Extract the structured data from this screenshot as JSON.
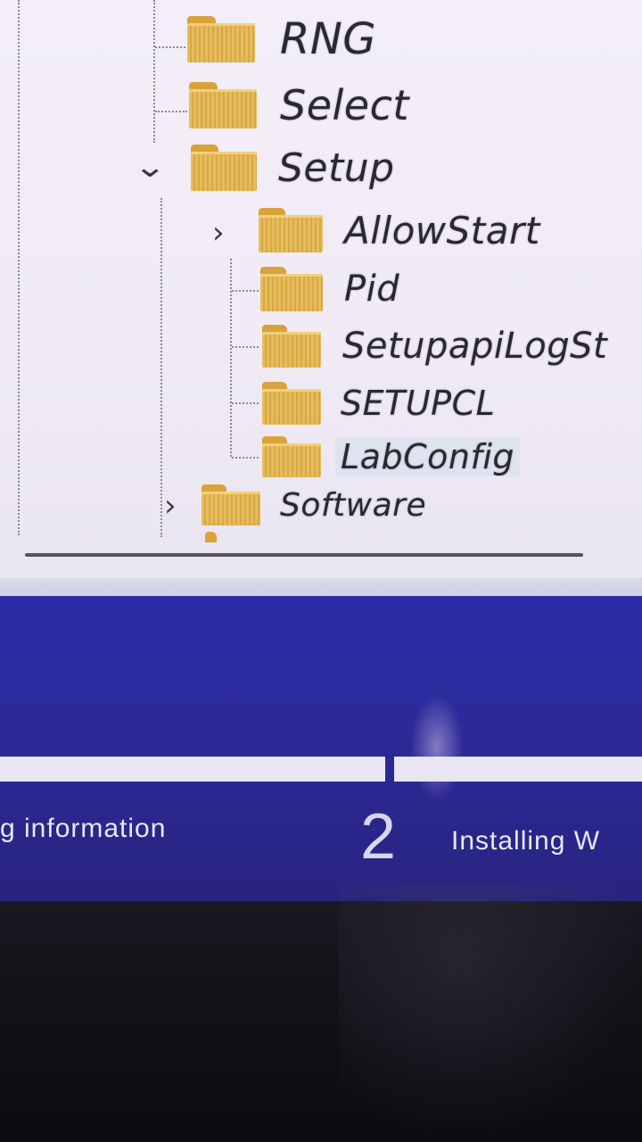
{
  "registry_tree": {
    "items": [
      {
        "label": "RNG"
      },
      {
        "label": "Select"
      },
      {
        "label": "Setup",
        "expanded": true
      },
      {
        "label": "AllowStart",
        "has_children": true
      },
      {
        "label": "Pid"
      },
      {
        "label": "SetupapiLogSt"
      },
      {
        "label": "SETUPCL"
      },
      {
        "label": "LabConfig",
        "selected": true
      },
      {
        "label": "Software",
        "has_children": true
      }
    ]
  },
  "setup_screen": {
    "step1_text": "g information",
    "step2_number": "2",
    "step2_text": "Installing W"
  },
  "colors": {
    "tree_background": "#f3eef7",
    "folder": "#e6bd5c",
    "setup_background": "#2c2da6",
    "progress_bar": "#e9e6f2"
  }
}
